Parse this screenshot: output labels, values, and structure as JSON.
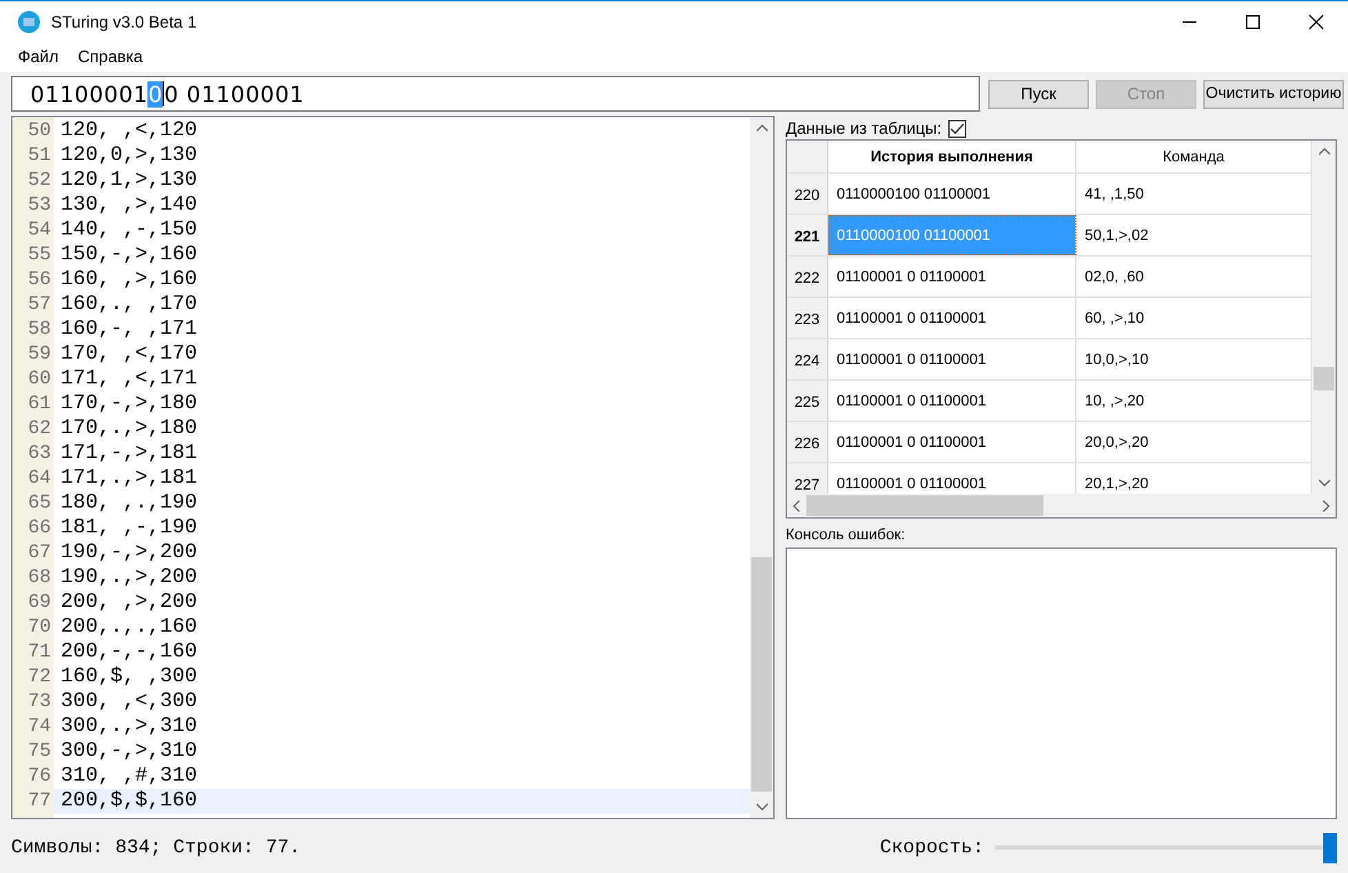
{
  "window": {
    "title": "STuring v3.0 Beta 1"
  },
  "menu": [
    "Файл",
    "Справка"
  ],
  "tape": {
    "before": "01100001",
    "head": "0",
    "after": "0 01100001"
  },
  "buttons": [
    {
      "label": "Пуск",
      "disabled": false
    },
    {
      "label": "Стоп",
      "disabled": true
    },
    {
      "label": "Очистить историю",
      "disabled": false
    }
  ],
  "editor": {
    "lines": [
      {
        "number": "50",
        "text": "120, ,<,120",
        "current": false
      },
      {
        "number": "51",
        "text": "120,0,>,130",
        "current": false
      },
      {
        "number": "52",
        "text": "120,1,>,130",
        "current": false
      },
      {
        "number": "53",
        "text": "130, ,>,140",
        "current": false
      },
      {
        "number": "54",
        "text": "140, ,-,150",
        "current": false
      },
      {
        "number": "55",
        "text": "150,-,>,160",
        "current": false
      },
      {
        "number": "56",
        "text": "160, ,>,160",
        "current": false
      },
      {
        "number": "57",
        "text": "160,., ,170",
        "current": false
      },
      {
        "number": "58",
        "text": "160,-, ,171",
        "current": false
      },
      {
        "number": "59",
        "text": "170, ,<,170",
        "current": false
      },
      {
        "number": "60",
        "text": "171, ,<,171",
        "current": false
      },
      {
        "number": "61",
        "text": "170,-,>,180",
        "current": false
      },
      {
        "number": "62",
        "text": "170,.,>,180",
        "current": false
      },
      {
        "number": "63",
        "text": "171,-,>,181",
        "current": false
      },
      {
        "number": "64",
        "text": "171,.,>,181",
        "current": false
      },
      {
        "number": "65",
        "text": "180, ,.,190",
        "current": false
      },
      {
        "number": "66",
        "text": "181, ,-,190",
        "current": false
      },
      {
        "number": "67",
        "text": "190,-,>,200",
        "current": false
      },
      {
        "number": "68",
        "text": "190,.,>,200",
        "current": false
      },
      {
        "number": "69",
        "text": "200, ,>,200",
        "current": false
      },
      {
        "number": "70",
        "text": "200,.,.,160",
        "current": false
      },
      {
        "number": "71",
        "text": "200,-,-,160",
        "current": false
      },
      {
        "number": "72",
        "text": "160,$, ,300",
        "current": false
      },
      {
        "number": "73",
        "text": "300, ,<,300",
        "current": false
      },
      {
        "number": "74",
        "text": "300,.,>,310",
        "current": false
      },
      {
        "number": "75",
        "text": "300,-,>,310",
        "current": false
      },
      {
        "number": "76",
        "text": "310, ,#,310",
        "current": false
      },
      {
        "number": "77",
        "text": "200,$,$,160",
        "current": true
      }
    ]
  },
  "status": {
    "counts": "Символы: 834; Строки: 77.",
    "speed_label": "Скорость:",
    "speed": {
      "level": 1
    }
  },
  "table_option": {
    "label": "Данные из таблицы:",
    "checked": true
  },
  "history": {
    "columns": [
      "История выполнения",
      "Команда"
    ],
    "rows": [
      {
        "number": "220",
        "tape": "0110000100 01100001",
        "command": "41, ,1,50",
        "selected": false
      },
      {
        "number": "221",
        "tape": "0110000100 01100001",
        "command": "50,1,>,02",
        "selected": true
      },
      {
        "number": "222",
        "tape": "01100001 0 01100001",
        "command": "02,0, ,60",
        "selected": false
      },
      {
        "number": "223",
        "tape": "01100001 0 01100001",
        "command": "60, ,>,10",
        "selected": false
      },
      {
        "number": "224",
        "tape": "01100001 0 01100001",
        "command": "10,0,>,10",
        "selected": false
      },
      {
        "number": "225",
        "tape": "01100001 0 01100001",
        "command": "10, ,>,20",
        "selected": false
      },
      {
        "number": "226",
        "tape": "01100001 0 01100001",
        "command": "20,0,>,20",
        "selected": false
      },
      {
        "number": "227",
        "tape": "01100001 0 01100001",
        "command": "20,1,>,20",
        "selected": false
      }
    ]
  },
  "console": {
    "label": "Консоль ошибок:"
  }
}
